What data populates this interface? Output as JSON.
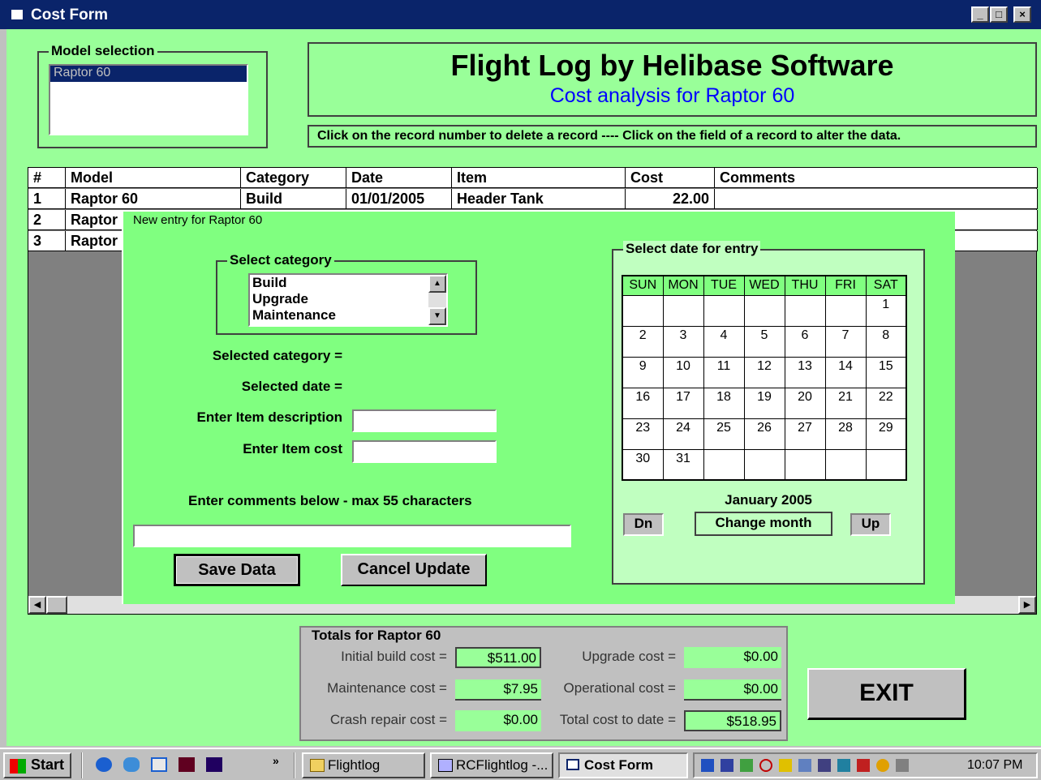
{
  "window": {
    "title": "Cost Form",
    "min": "_",
    "max": "□",
    "close": "×"
  },
  "model_selection": {
    "legend": "Model selection",
    "items": [
      "Raptor 60"
    ]
  },
  "banner": {
    "title": "Flight Log by Helibase Software",
    "subtitle": "Cost analysis for Raptor 60"
  },
  "instruction": "Click on the record number to delete a record ---- Click on the field of a record to alter the data.",
  "grid": {
    "columns": [
      "#",
      "Model",
      "Category",
      "Date",
      "Item",
      "Cost",
      "Comments"
    ],
    "rows": [
      {
        "num": "1",
        "model": "Raptor 60",
        "category": "Build",
        "date": "01/01/2005",
        "item": "Header Tank",
        "cost": "22.00",
        "comments": ""
      },
      {
        "num": "2",
        "model": "Raptor",
        "category": "",
        "date": "",
        "item": "",
        "cost": "",
        "comments": ""
      },
      {
        "num": "3",
        "model": "Raptor",
        "category": "",
        "date": "",
        "item": "",
        "cost": "",
        "comments": ""
      }
    ]
  },
  "entry": {
    "frame_title": "New entry for Raptor 60",
    "category_legend": "Select category",
    "categories": [
      "Build",
      "Upgrade",
      "Maintenance"
    ],
    "selected_category_label": "Selected category =",
    "selected_date_label": "Selected date =",
    "item_desc_label": "Enter Item description",
    "item_cost_label": "Enter Item cost",
    "comments_label": "Enter comments below - max 55 characters",
    "save_label": "Save Data",
    "cancel_label": "Cancel Update"
  },
  "calendar": {
    "legend": "Select date for entry",
    "days": [
      "SUN",
      "MON",
      "TUE",
      "WED",
      "THU",
      "FRI",
      "SAT"
    ],
    "weeks": [
      [
        "",
        "",
        "",
        "",
        "",
        "",
        "1"
      ],
      [
        "2",
        "3",
        "4",
        "5",
        "6",
        "7",
        "8"
      ],
      [
        "9",
        "10",
        "11",
        "12",
        "13",
        "14",
        "15"
      ],
      [
        "16",
        "17",
        "18",
        "19",
        "20",
        "21",
        "22"
      ],
      [
        "23",
        "24",
        "25",
        "26",
        "27",
        "28",
        "29"
      ],
      [
        "30",
        "31",
        "",
        "",
        "",
        "",
        ""
      ]
    ],
    "month_label": "January 2005",
    "dn_label": "Dn",
    "change_label": "Change month",
    "up_label": "Up"
  },
  "totals": {
    "legend": "Totals for Raptor 60",
    "initial_label": "Initial build cost =",
    "initial_value": "$511.00",
    "upgrade_label": "Upgrade cost =",
    "upgrade_value": "$0.00",
    "maint_label": "Maintenance cost =",
    "maint_value": "$7.95",
    "oper_label": "Operational cost =",
    "oper_value": "$0.00",
    "crash_label": "Crash repair cost =",
    "crash_value": "$0.00",
    "total_label": "Total cost to date =",
    "total_value": "$518.95"
  },
  "exit_label": "EXIT",
  "taskbar": {
    "start": "Start",
    "chevron": "»",
    "tasks": [
      "Flightlog",
      "RCFlightlog -...",
      "Cost Form"
    ],
    "clock": "10:07 PM"
  }
}
